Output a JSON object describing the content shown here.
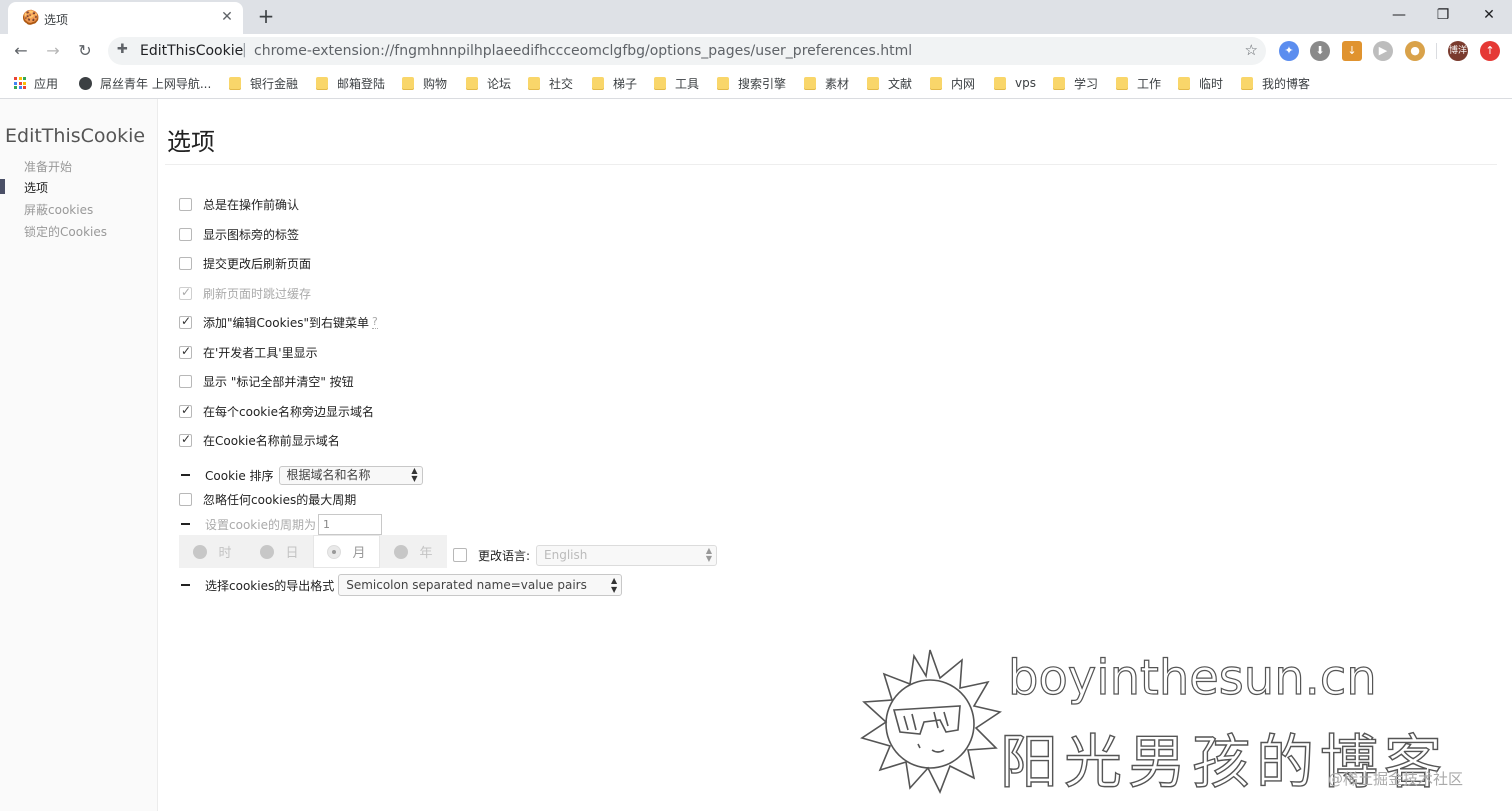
{
  "browser": {
    "tab": {
      "favicon": "cookie-icon",
      "title": "选项",
      "close": "✕"
    },
    "new_tab": "+",
    "window_controls": {
      "minimize": "—",
      "restore": "❐",
      "close": "✕"
    },
    "nav": {
      "back": "←",
      "forward": "→",
      "reload": "↻"
    },
    "address": {
      "site_name": "EditThisCookie",
      "separator": "|",
      "url": "chrome-extension://fngmhnnpilhplaeedifhccceomclgfbg/options_pages/user_preferences.html"
    },
    "profile_label": "博洋"
  },
  "bookmarks": [
    {
      "label": "应用",
      "icon": "apps-icon"
    },
    {
      "label": "屌丝青年 上网导航...",
      "icon": "globe-icon"
    },
    {
      "label": "银行金融",
      "icon": "folder-icon"
    },
    {
      "label": "邮箱登陆",
      "icon": "folder-icon"
    },
    {
      "label": "购物",
      "icon": "folder-icon"
    },
    {
      "label": "论坛",
      "icon": "folder-icon"
    },
    {
      "label": "社交",
      "icon": "folder-icon"
    },
    {
      "label": "梯子",
      "icon": "folder-icon"
    },
    {
      "label": "工具",
      "icon": "folder-icon"
    },
    {
      "label": "搜索引擎",
      "icon": "folder-icon"
    },
    {
      "label": "素材",
      "icon": "folder-icon"
    },
    {
      "label": "文献",
      "icon": "folder-icon"
    },
    {
      "label": "内网",
      "icon": "folder-icon"
    },
    {
      "label": "vps",
      "icon": "folder-icon"
    },
    {
      "label": "学习",
      "icon": "folder-icon"
    },
    {
      "label": "工作",
      "icon": "folder-icon"
    },
    {
      "label": "临时",
      "icon": "folder-icon"
    },
    {
      "label": "我的博客",
      "icon": "folder-icon"
    }
  ],
  "sidebar": {
    "brand": "EditThisCookie",
    "items": [
      {
        "label": "准备开始",
        "active": false
      },
      {
        "label": "选项",
        "active": true
      },
      {
        "label": "屏蔽cookies",
        "active": false
      },
      {
        "label": "锁定的Cookies",
        "active": false
      }
    ]
  },
  "page": {
    "title": "选项",
    "options": [
      {
        "label": "总是在操作前确认",
        "checked": false,
        "disabled": false
      },
      {
        "label": "显示图标旁的标签",
        "checked": false,
        "disabled": false
      },
      {
        "label": "提交更改后刷新页面",
        "checked": false,
        "disabled": false
      },
      {
        "label": "刷新页面时跳过缓存",
        "checked": true,
        "disabled": true
      },
      {
        "label": "添加\"编辑Cookies\"到右键菜单",
        "checked": true,
        "disabled": false,
        "help": "?"
      },
      {
        "label": "在'开发者工具'里显示",
        "checked": true,
        "disabled": false
      },
      {
        "label": "显示 \"标记全部并清空\" 按钮",
        "checked": false,
        "disabled": false
      },
      {
        "label": "在每个cookie名称旁边显示域名",
        "checked": true,
        "disabled": false
      },
      {
        "label": "在Cookie名称前显示域名",
        "checked": true,
        "disabled": false
      }
    ],
    "sort": {
      "label": "Cookie 排序",
      "value": "根据域名和名称"
    },
    "ignore_max_age": {
      "label": "忽略任何cookies的最大周期",
      "checked": false
    },
    "period": {
      "label": "设置cookie的周期为",
      "value": "1",
      "units": [
        {
          "label": "时",
          "selected": false
        },
        {
          "label": "日",
          "selected": false
        },
        {
          "label": "月",
          "selected": true
        },
        {
          "label": "年",
          "selected": false
        }
      ]
    },
    "language": {
      "label": "更改语言:",
      "value": "English",
      "checked": false
    },
    "export_format": {
      "label": "选择cookies的导出格式",
      "value": "Semicolon separated name=value pairs"
    }
  },
  "watermark": {
    "domain": "boyinthesun.cn",
    "tagline": "阳光男孩的博客",
    "credit": "@稀土掘金技术社区"
  },
  "colors": {
    "sidebar_marker": "#4a4f66",
    "folder": "#f9d66a",
    "tabstrip": "#dee1e6"
  }
}
